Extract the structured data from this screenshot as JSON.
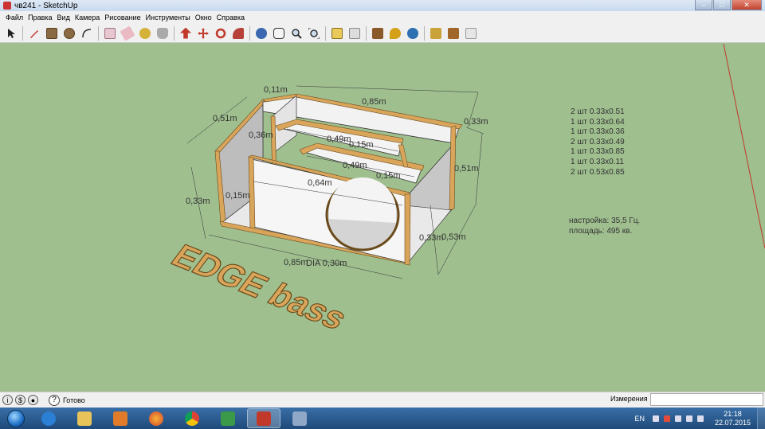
{
  "window": {
    "title": "чв241 - SketchUp",
    "buttons": [
      "–",
      "□",
      "✕"
    ]
  },
  "menu": [
    "Файл",
    "Правка",
    "Вид",
    "Камера",
    "Рисование",
    "Инструменты",
    "Окно",
    "Справка"
  ],
  "toolbar": {
    "tools": [
      "select-tool",
      "line-tool",
      "rectangle-tool",
      "circle-tool",
      "arc-tool",
      "make-component-tool",
      "eraser-tool",
      "tape-measure-tool",
      "paint-bucket-tool",
      "push-pull-tool",
      "move-tool",
      "rotate-tool",
      "follow-me-tool",
      "orbit-tool",
      "pan-tool",
      "zoom-tool",
      "zoom-extents-tool",
      "section-plane-tool",
      "section-display-tool",
      "warehouse-tool",
      "geo-location-tool",
      "photo-texture-tool",
      "components-tool",
      "styles-tool",
      "layers-tool"
    ]
  },
  "model": {
    "dimensions": {
      "top_depth": "0,51m",
      "top_width": "0,85m",
      "small_thickness": "0,11m",
      "right_height_top": "0,33m",
      "inner_depth": "0,36m",
      "shelf1_width": "0,49m",
      "shelf1_gap": "0,15m",
      "shelf2_width": "0,49m",
      "right_depth": "0,51m",
      "shelf2_gap": "0,15m",
      "front_width": "0,64m",
      "left_height": "0,33m",
      "left_gap": "0,15m",
      "right_height": "0,33m",
      "right_span": "0,53m",
      "bottom_width": "0,85m",
      "hole_dia": "DIA 0,30m"
    },
    "logo_text": "EDGE bass"
  },
  "notes": {
    "parts": [
      "2 шт 0.33x0.51",
      "1 шт 0.33x0.64",
      "1 шт 0.33x0.36",
      "2 шт 0.33x0.49",
      "1 шт 0.33x0.85",
      "1 шт 0.33x0.11",
      "2 шт 0.53x0.85"
    ],
    "tuning": "настройка: 35,5 Гц.",
    "area": "площадь: 495 кв."
  },
  "status": {
    "text": "Готово",
    "measure_label": "Измерения",
    "measure_value": ""
  },
  "taskbar": {
    "apps": [
      "internet-explorer",
      "file-explorer",
      "media-player",
      "firefox",
      "chrome",
      "task-manager",
      "sketchup",
      "calculator"
    ],
    "language": "EN",
    "time": "21:18",
    "date": "22.07.2015"
  },
  "colors": {
    "viewport": "#9fbf8f",
    "board_edge": "#d9a55b",
    "panel": "#f2f2f2",
    "shade": "#c8c8c8",
    "axis_red": "#c0392b"
  }
}
